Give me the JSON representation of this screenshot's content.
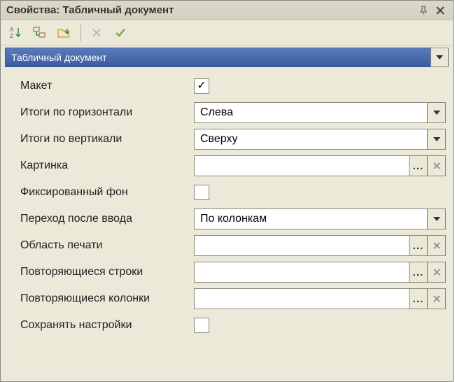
{
  "titlebar": {
    "title": "Свойства: Табличный документ"
  },
  "header": {
    "label": "Табличный документ"
  },
  "props": {
    "maket": {
      "label": "Макет",
      "checked": true
    },
    "totals_h": {
      "label": "Итоги по горизонтали",
      "value": "Слева"
    },
    "totals_v": {
      "label": "Итоги по вертикали",
      "value": "Сверху"
    },
    "picture": {
      "label": "Картинка",
      "value": ""
    },
    "fixed_bg": {
      "label": "Фиксированный фон",
      "checked": false
    },
    "input_transition": {
      "label": "Переход после ввода",
      "value": "По колонкам"
    },
    "print_area": {
      "label": "Область печати",
      "value": ""
    },
    "repeat_rows": {
      "label": "Повторяющиеся строки",
      "value": ""
    },
    "repeat_cols": {
      "label": "Повторяющиеся колонки",
      "value": ""
    },
    "save_settings": {
      "label": "Сохранять настройки",
      "checked": false
    }
  }
}
